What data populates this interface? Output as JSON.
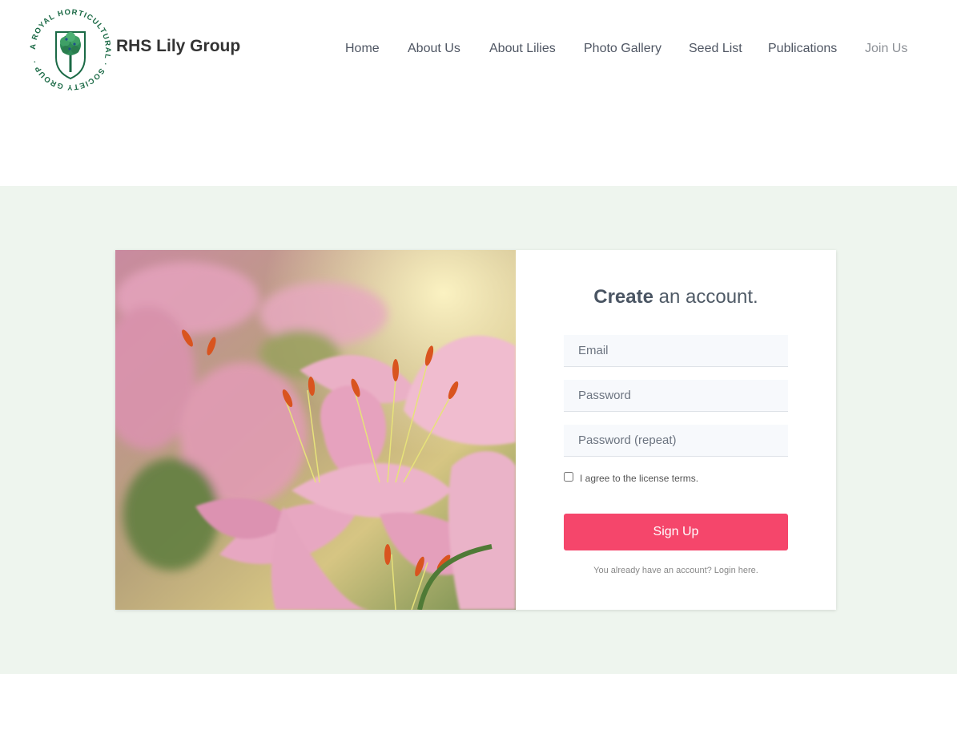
{
  "brand": {
    "name": "RHS Lily Group",
    "logo_ring_text": "A ROYAL HORTICULTURAL · SOCIETY GROUP ·",
    "logo_color": "#1b6a46"
  },
  "nav": {
    "items": [
      {
        "label": "Home"
      },
      {
        "label": "About Us"
      },
      {
        "label": "About Lilies"
      },
      {
        "label": "Photo Gallery"
      },
      {
        "label": "Seed List"
      },
      {
        "label": "Publications"
      },
      {
        "label": "Join Us"
      }
    ]
  },
  "signup_form": {
    "title_bold": "Create",
    "title_rest": " an account.",
    "email_placeholder": "Email",
    "password_placeholder": "Password",
    "password_repeat_placeholder": "Password (repeat)",
    "agree_label": "I agree to the license terms.",
    "agree_checked": false,
    "submit_label": "Sign Up",
    "login_prompt": "You already have an account? Login here."
  },
  "colors": {
    "accent": "#f5466b",
    "band_background": "#eef5ee",
    "logo_green": "#1b6a46"
  }
}
